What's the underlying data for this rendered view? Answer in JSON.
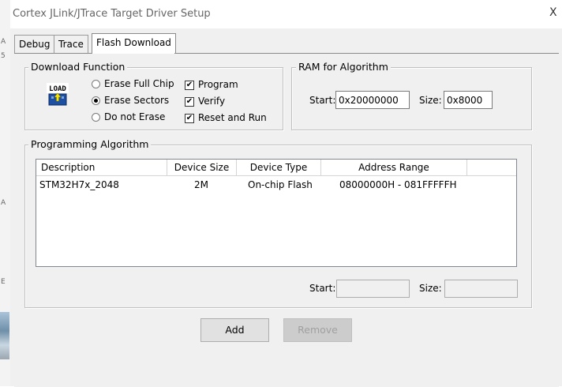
{
  "window": {
    "title": "Cortex JLink/JTrace Target Driver Setup",
    "close_glyph": "X"
  },
  "tabs": [
    {
      "label": "Debug"
    },
    {
      "label": "Trace"
    },
    {
      "label": "Flash Download"
    }
  ],
  "download_function": {
    "title": "Download Function",
    "icon_text": "LOAD",
    "radios": [
      {
        "label": "Erase Full Chip",
        "checked": false
      },
      {
        "label": "Erase Sectors",
        "checked": true
      },
      {
        "label": "Do not Erase",
        "checked": false
      }
    ],
    "checks": [
      {
        "label": "Program",
        "checked": true
      },
      {
        "label": "Verify",
        "checked": true
      },
      {
        "label": "Reset and Run",
        "checked": true
      }
    ]
  },
  "ram": {
    "title": "RAM for Algorithm",
    "start_label": "Start:",
    "start_value": "0x20000000",
    "size_label": "Size:",
    "size_value": "0x8000"
  },
  "programming": {
    "title": "Programming Algorithm",
    "columns": [
      "Description",
      "Device Size",
      "Device Type",
      "Address Range"
    ],
    "rows": [
      [
        "STM32H7x_2048",
        "2M",
        "On-chip Flash",
        "08000000H - 081FFFFFH"
      ]
    ],
    "start_label": "Start:",
    "start_value": "",
    "size_label": "Size:",
    "size_value": ""
  },
  "buttons": {
    "add": "Add",
    "remove": "Remove"
  },
  "check_glyph": "✔"
}
